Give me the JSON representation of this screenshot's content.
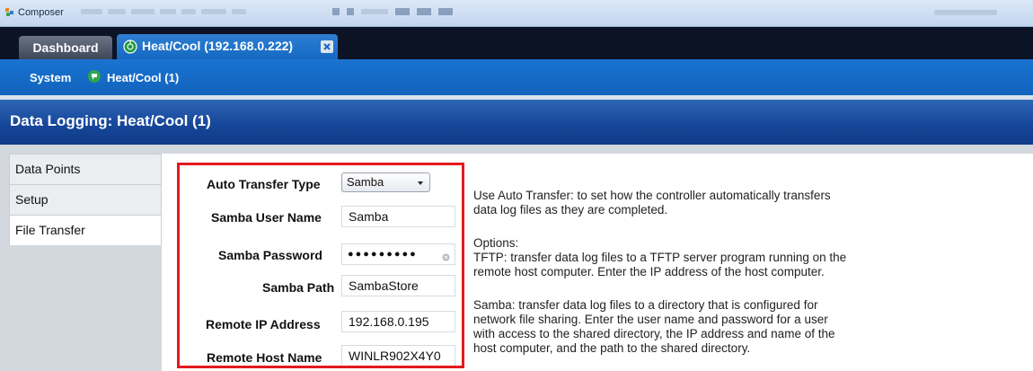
{
  "app": {
    "title": "Composer"
  },
  "colors": {
    "accent": "#1569c2",
    "header": "#17479a",
    "highlight_box": "#e3191c"
  },
  "tabs": [
    {
      "label": "Dashboard",
      "active": false
    },
    {
      "label": "Heat/Cool (192.168.0.222)",
      "active": true,
      "icon": "thermostat-icon",
      "closable": true
    }
  ],
  "breadcrumb": {
    "root": "System",
    "device_icon": "thermostat-icon",
    "device": "Heat/Cool (1)"
  },
  "page": {
    "title": "Data Logging: Heat/Cool (1)"
  },
  "sidebar": {
    "items": [
      {
        "label": "Data Points",
        "active": false
      },
      {
        "label": "Setup",
        "active": false
      },
      {
        "label": "File Transfer",
        "active": true
      }
    ]
  },
  "form": {
    "auto_transfer_type": {
      "label": "Auto Transfer Type",
      "value": "Samba"
    },
    "samba_user_name": {
      "label": "Samba User Name",
      "value": "Samba"
    },
    "samba_password": {
      "label": "Samba Password",
      "value": "●●●●●●●●●"
    },
    "samba_path": {
      "label": "Samba Path",
      "value": "SambaStore"
    },
    "remote_ip_address": {
      "label": "Remote IP Address",
      "value": "192.168.0.195"
    },
    "remote_host_name": {
      "label": "Remote Host Name",
      "value": "WINLR902X4Y0"
    }
  },
  "help": {
    "line1": "Use Auto Transfer: to set how the controller automatically transfers",
    "line2": "data log files as they are completed.",
    "options_heading": "Options:",
    "tftp1": "TFTP: transfer data log files to a TFTP server program running on the",
    "tftp2": "remote host computer. Enter the IP address of the host computer.",
    "samba1": "Samba: transfer data log files to a directory that is configured for",
    "samba2": "network file sharing. Enter the user name and password  for a user",
    "samba3": "with access to the shared directory, the IP address and name of the",
    "samba4": "host computer, and the  path to the shared directory."
  }
}
